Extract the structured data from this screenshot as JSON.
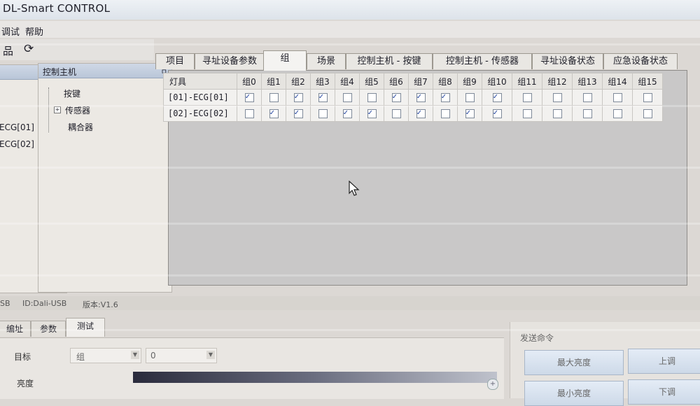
{
  "window": {
    "title": "DL-Smart CONTROL"
  },
  "menu": {
    "items": [
      "调试",
      "帮助"
    ]
  },
  "left_panel": {
    "items": [
      "ECG[01]",
      "ECG[02]"
    ]
  },
  "middle_panel": {
    "title": "控制主机",
    "pin": "ㅁ",
    "tree": [
      "按键",
      "传感器",
      "耦合器"
    ]
  },
  "tabs": [
    "项目",
    "寻址设备参数",
    "组",
    "场景",
    "控制主机 - 按键",
    "控制主机 - 传感器",
    "寻址设备状态",
    "应急设备状态"
  ],
  "active_tab": 2,
  "group_table": {
    "header_label": "灯具",
    "groups": [
      "组0",
      "组1",
      "组2",
      "组3",
      "组4",
      "组5",
      "组6",
      "组7",
      "组8",
      "组9",
      "组10",
      "组11",
      "组12",
      "组13",
      "组14",
      "组15"
    ],
    "rows": [
      {
        "label": "[01]-ECG[01]",
        "checked": [
          1,
          0,
          1,
          1,
          0,
          0,
          1,
          1,
          1,
          0,
          1,
          0,
          0,
          0,
          0,
          0
        ]
      },
      {
        "label": "[02]-ECG[02]",
        "checked": [
          0,
          1,
          1,
          0,
          1,
          1,
          0,
          1,
          0,
          1,
          1,
          0,
          0,
          0,
          0,
          0
        ]
      }
    ]
  },
  "statusbar": {
    "port": "SB",
    "id": "ID:Dali-USB",
    "version": "版本:V1.6"
  },
  "bottom": {
    "tabs": [
      "编址",
      "参数",
      "测试"
    ],
    "active_tab": 2,
    "target_label": "目标",
    "target_value": "组",
    "target_number": "0",
    "brightness_label": "亮度"
  },
  "command_panel": {
    "title": "发送命令",
    "buttons": [
      "最大亮度",
      "上调",
      "最小亮度",
      "下调"
    ]
  }
}
